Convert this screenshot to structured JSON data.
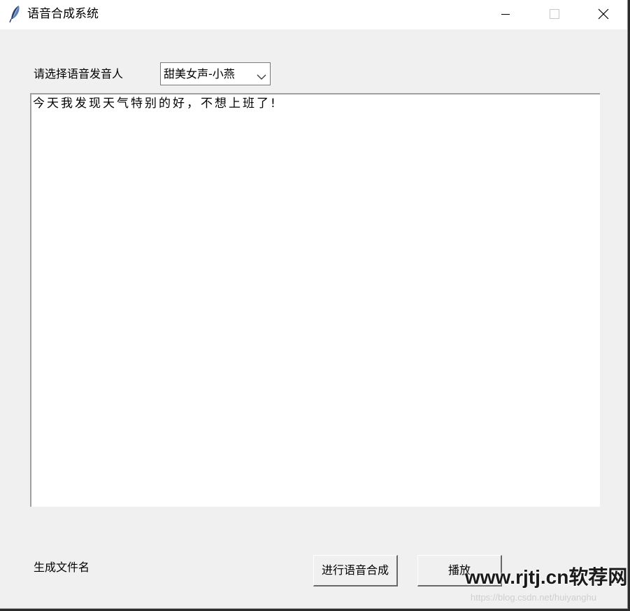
{
  "window": {
    "title": "语音合成系统",
    "icon": "feather-icon",
    "controls": {
      "minimize": "minimize-icon",
      "maximize": "maximize-icon",
      "close": "close-icon"
    }
  },
  "speaker": {
    "label": "请选择语音发音人",
    "selected": "甜美女声-小燕"
  },
  "text_input": {
    "value": "今天我发现天气特别的好，不想上班了!"
  },
  "footer": {
    "file_label": "生成文件名",
    "synthesize_label": "进行语音合成",
    "play_label": "播放"
  },
  "watermark": {
    "site": "www.rjtj.cn软荐网",
    "url": "https://blog.csdn.net/huiyanghu"
  }
}
